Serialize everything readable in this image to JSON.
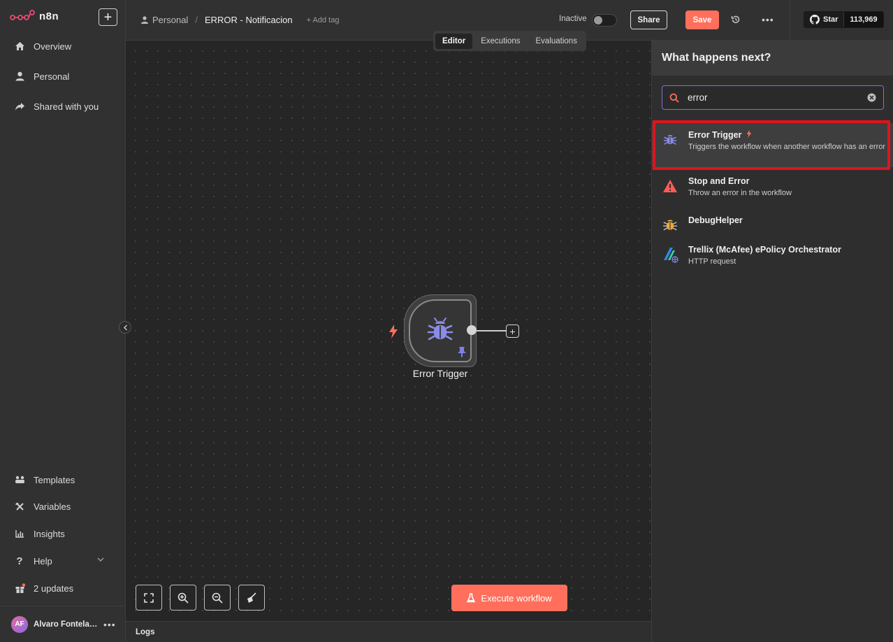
{
  "app": {
    "name": "n8n"
  },
  "sidebar": {
    "top_items": [
      {
        "label": "Overview",
        "icon": "home-icon"
      },
      {
        "label": "Personal",
        "icon": "user-icon"
      },
      {
        "label": "Shared with you",
        "icon": "share-icon"
      }
    ],
    "bottom_items": [
      {
        "label": "Templates",
        "icon": "templates-icon"
      },
      {
        "label": "Variables",
        "icon": "variables-icon"
      },
      {
        "label": "Insights",
        "icon": "insights-icon"
      },
      {
        "label": "Help",
        "icon": "help-icon"
      },
      {
        "label": "2 updates",
        "icon": "gift-icon"
      }
    ],
    "user": {
      "initials": "AF",
      "name": "Alvaro Fontela ..."
    }
  },
  "header": {
    "project": "Personal",
    "workflow_title": "ERROR - Notificacion",
    "add_tag": "+ Add tag",
    "status_label": "Inactive",
    "share_label": "Share",
    "save_label": "Save",
    "github_star_label": "Star",
    "github_star_count": "113,969"
  },
  "tabs": [
    {
      "label": "Editor",
      "active": true
    },
    {
      "label": "Executions",
      "active": false
    },
    {
      "label": "Evaluations",
      "active": false
    }
  ],
  "canvas": {
    "node": {
      "label": "Error Trigger",
      "icon": "bug-icon"
    },
    "execute_label": "Execute workflow"
  },
  "logs": {
    "label": "Logs"
  },
  "panel": {
    "title": "What happens next?",
    "search_value": "error",
    "results": [
      {
        "title": "Error Trigger",
        "description": "Triggers the workflow when another workflow has an error",
        "icon": "bug-icon",
        "selected": true
      },
      {
        "title": "Stop and Error",
        "description": "Throw an error in the workflow",
        "icon": "warning-icon",
        "selected": false
      },
      {
        "title": "DebugHelper",
        "description": "",
        "icon": "debug-bug-icon",
        "selected": false
      },
      {
        "title": "Trellix (McAfee) ePolicy Orchestrator",
        "description": "HTTP request",
        "icon": "trellix-icon",
        "selected": false
      }
    ]
  },
  "colors": {
    "accent": "#ff6f5c",
    "node_icon": "#7f7fe8",
    "highlight": "#e0141c",
    "search_border": "#7b73e0"
  }
}
